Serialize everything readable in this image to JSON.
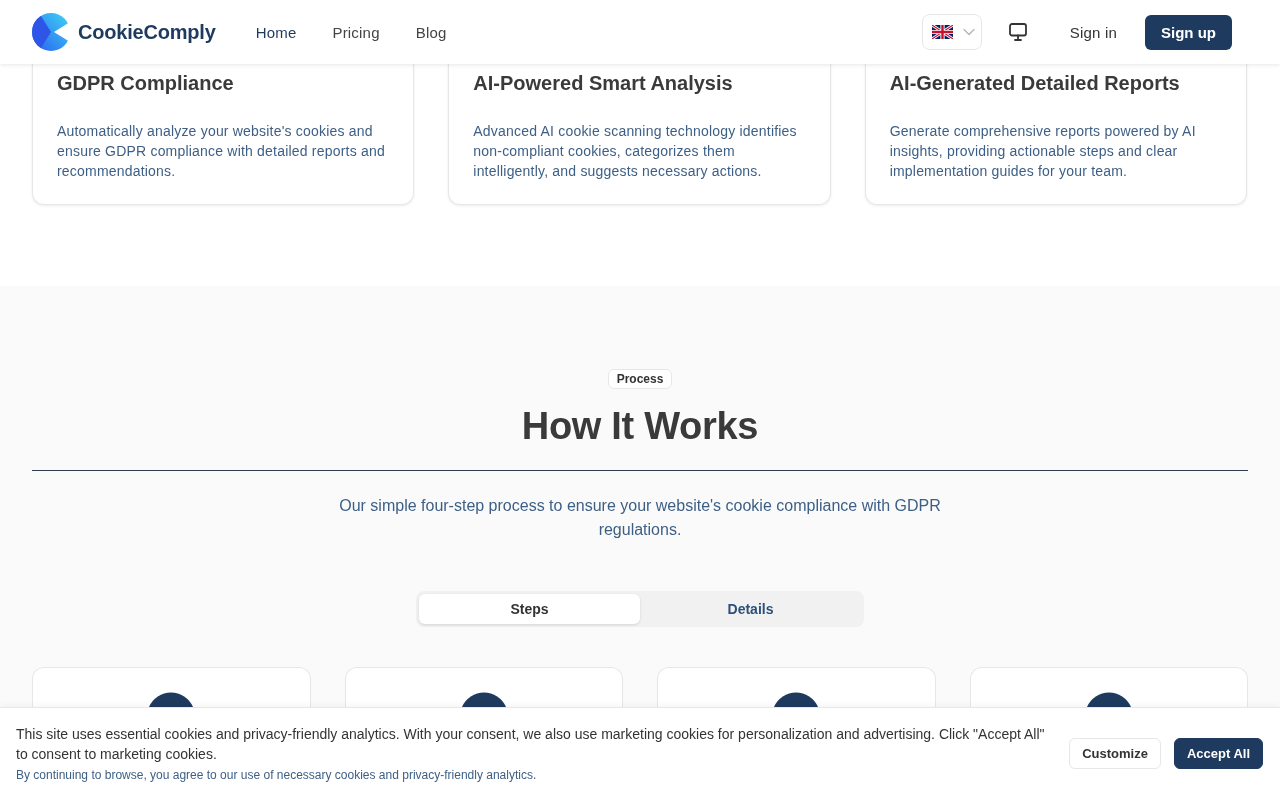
{
  "header": {
    "brand": "CookieComply",
    "nav": [
      {
        "label": "Home",
        "selected": true
      },
      {
        "label": "Pricing",
        "selected": false
      },
      {
        "label": "Blog",
        "selected": false
      }
    ],
    "actions": [
      {
        "label": "Sign in",
        "kind": "text"
      },
      {
        "label": "Sign up",
        "kind": "primary"
      }
    ]
  },
  "features": [
    {
      "title": "GDPR Compliance",
      "description": "Automatically analyze your website's cookies and ensure GDPR compliance with detailed reports and recommendations."
    },
    {
      "title": "AI-Powered Smart Analysis",
      "description": "Advanced AI cookie scanning technology identifies non-compliant cookies, categorizes them intelligently, and suggests necessary actions."
    },
    {
      "title": "AI-Generated Detailed Reports",
      "description": "Generate comprehensive reports powered by AI insights, providing actionable steps and clear implementation guides for your team."
    }
  ],
  "process": {
    "badge": "Process",
    "title": "How It Works",
    "subtitle": "Our simple four-step process to ensure your website's cookie compliance with GDPR regulations.",
    "tabs": [
      {
        "label": "Steps",
        "selected": true
      },
      {
        "label": "Details",
        "selected": false
      }
    ]
  },
  "cookie_banner": {
    "message": "This site uses essential cookies and privacy-friendly analytics. With your consent, we also use marketing cookies for personalization and advertising. Click \"Accept All\" to consent to marketing cookies.",
    "note": "By continuing to browse, you agree to our use of necessary cookies and privacy-friendly analytics.",
    "buttons": [
      {
        "label": "Customize",
        "kind": "secondary"
      },
      {
        "label": "Accept All",
        "kind": "primary"
      }
    ]
  }
}
